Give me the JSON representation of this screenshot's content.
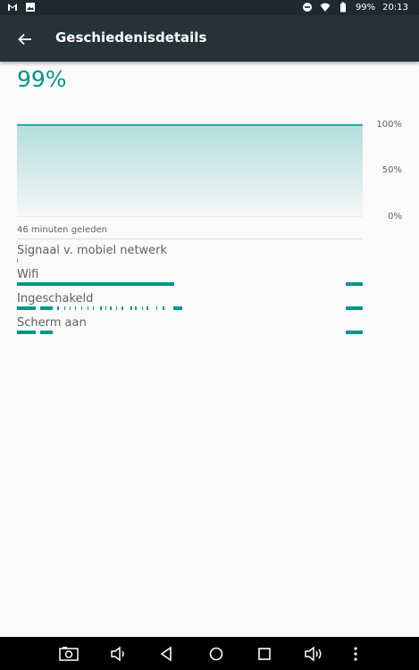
{
  "status_bar": {
    "battery": "99%",
    "time": "20:13",
    "icons": [
      "gmail-icon",
      "image-icon",
      "do-not-disturb-icon",
      "wifi-icon",
      "battery-icon"
    ]
  },
  "app_bar": {
    "title": "Geschiedenisdetails",
    "back_icon": "arrow-left-icon"
  },
  "battery": {
    "percent": "99%",
    "level": 0.99
  },
  "chart": {
    "y_labels": [
      "100%",
      "50%",
      "0%"
    ],
    "x_label": "46 minuten geleden",
    "accent": "#009688"
  },
  "rows": [
    {
      "label": "Signaal v. mobiel netwerk"
    },
    {
      "label": "Wifi"
    },
    {
      "label": "Ingeschakeld"
    },
    {
      "label": "Scherm aan"
    }
  ],
  "nav_bar": {
    "icons": [
      "screenshot-icon",
      "volume-down-icon",
      "back-icon",
      "home-icon",
      "recents-icon",
      "volume-up-icon",
      "menu-icon"
    ]
  }
}
